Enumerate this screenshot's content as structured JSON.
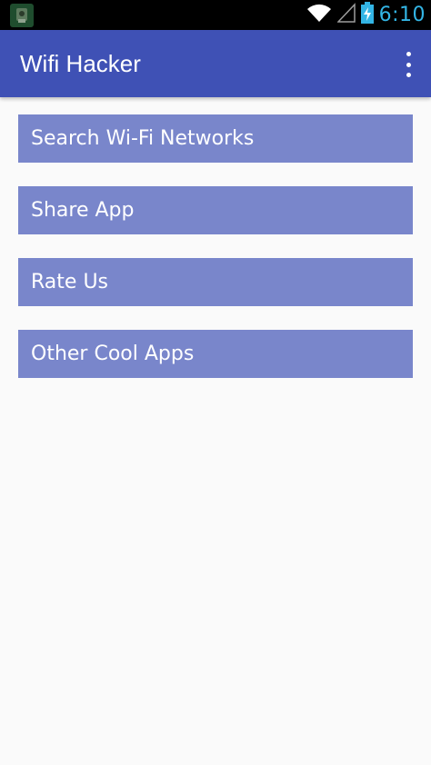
{
  "status_bar": {
    "time": "6:10",
    "icons": [
      "app-thumbnail-icon",
      "wifi-icon",
      "signal-icon",
      "battery-charging-icon"
    ],
    "clock_color": "#33b5e5"
  },
  "app_bar": {
    "title": "Wifi Hacker",
    "background": "#3f51b5",
    "overflow_icon": "more-vert-icon"
  },
  "menu": {
    "button_color": "#7986cb",
    "items": [
      {
        "label": "Search Wi-Fi Networks"
      },
      {
        "label": "Share App"
      },
      {
        "label": "Rate Us"
      },
      {
        "label": "Other Cool Apps"
      }
    ]
  }
}
